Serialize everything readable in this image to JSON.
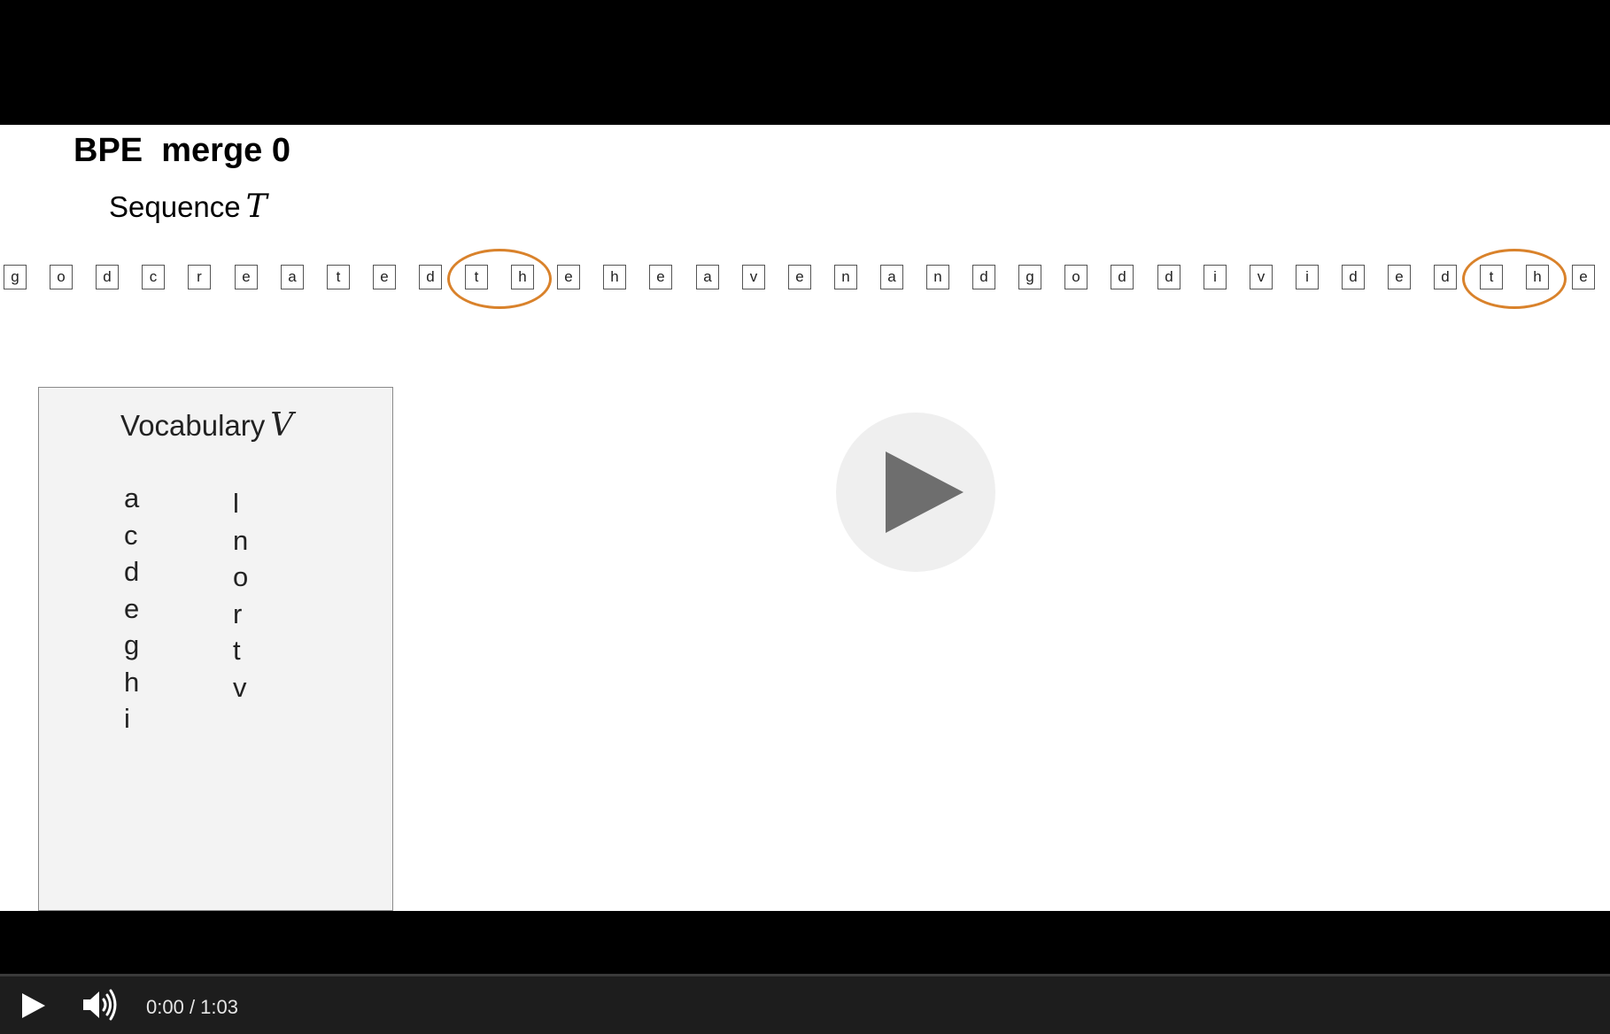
{
  "slide": {
    "title": "BPE  merge 0",
    "sequence_label": "Sequence",
    "sequence_var": "T",
    "sequence": [
      "g",
      "o",
      "d",
      "c",
      "r",
      "e",
      "a",
      "t",
      "e",
      "d",
      "t",
      "h",
      "e",
      "h",
      "e",
      "a",
      "v",
      "e",
      "n",
      "a",
      "n",
      "d",
      "g",
      "o",
      "d",
      "d",
      "i",
      "v",
      "i",
      "d",
      "e",
      "d",
      "t",
      "h",
      "e"
    ],
    "highlighted_pair": [
      "t",
      "h"
    ],
    "highlight_color": "#d9822b",
    "vocabulary": {
      "title": "Vocabulary",
      "var": "V",
      "column1": [
        "a",
        "c",
        "d",
        "e",
        "g",
        "h",
        "i"
      ],
      "column2": [
        "l",
        "n",
        "o",
        "r",
        "t",
        "v"
      ]
    }
  },
  "player": {
    "current_time": "0:00",
    "separator": " / ",
    "duration": "1:03",
    "big_play_icon": "play-icon",
    "play_icon": "play-icon",
    "volume_icon": "volume-icon"
  }
}
